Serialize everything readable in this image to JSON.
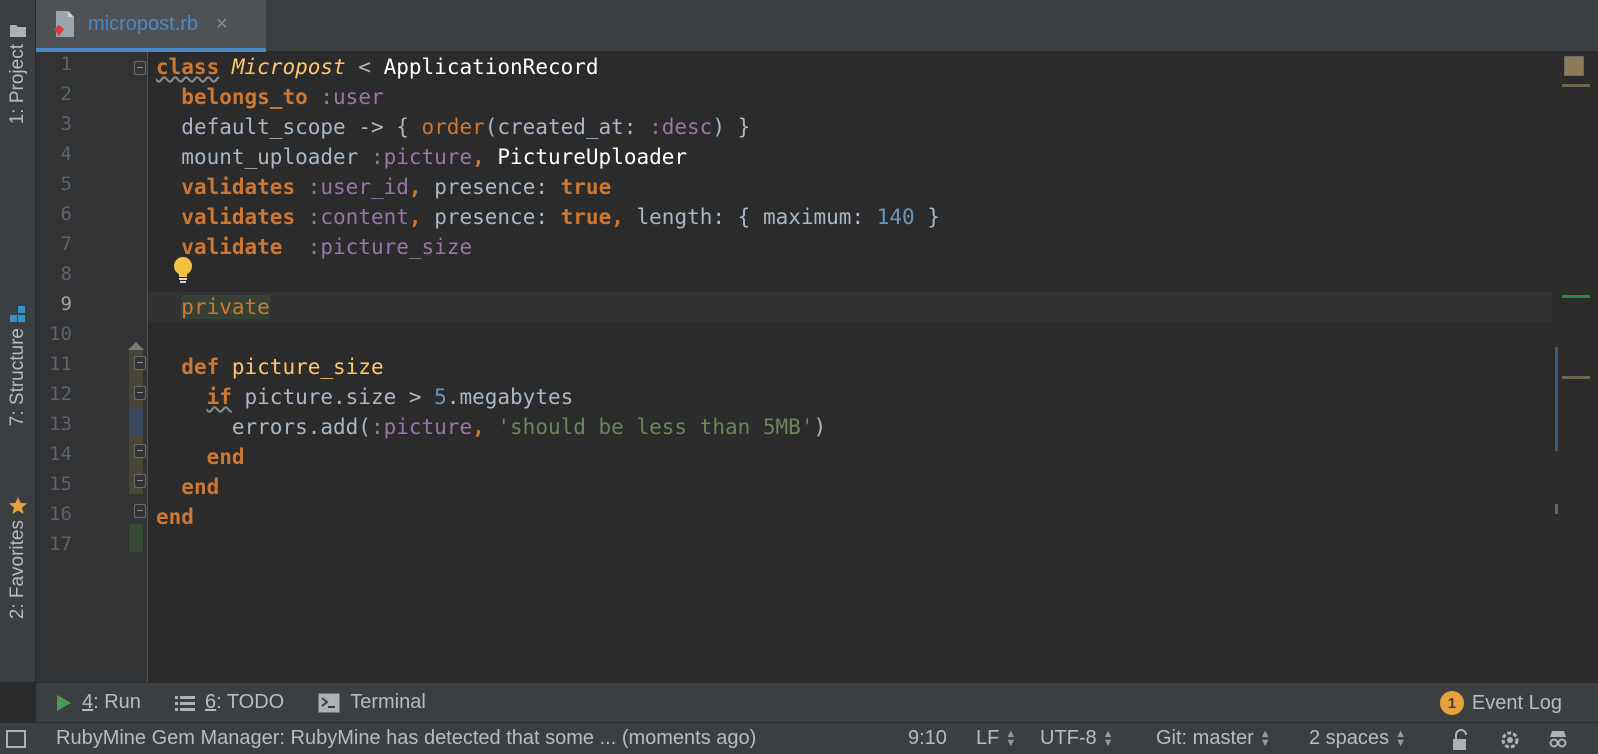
{
  "left_tabs": [
    {
      "label": "1: Project",
      "icon": "folder-icon"
    },
    {
      "label": "7: Structure",
      "icon": "structure-icon"
    },
    {
      "label": "2: Favorites",
      "icon": "star-icon"
    }
  ],
  "editor_tab": {
    "label": "micropost.rb",
    "close": "×"
  },
  "line_numbers": [
    "1",
    "2",
    "3",
    "4",
    "5",
    "6",
    "7",
    "8",
    "9",
    "10",
    "11",
    "12",
    "13",
    "14",
    "15",
    "16",
    "17"
  ],
  "current_line": "9",
  "code": {
    "l1": {
      "kw": "class",
      "name": "Micropost",
      "op": " < ",
      "parent": "ApplicationRecord"
    },
    "l2": {
      "call": "belongs_to",
      "sym": ":user"
    },
    "l3": {
      "a": "default_scope -> { ",
      "call": "order",
      "b": "(created_at: ",
      "sym": ":desc",
      "c": ") }"
    },
    "l4": {
      "a": "mount_uploader ",
      "sym": ":picture",
      "comma": ", ",
      "cls": "PictureUploader"
    },
    "l5": {
      "call": "validates",
      "sym": ":user_id",
      "comma": ", ",
      "key": "presence: ",
      "lit": "true"
    },
    "l6": {
      "call": "validates",
      "sym": ":content",
      "comma": ", ",
      "key": "presence: ",
      "lit": "true",
      "comma2": ", ",
      "key2": "length: { maximum: ",
      "num": "140",
      "end": " }"
    },
    "l7": {
      "call": "validate",
      "sym": "  :picture_size"
    },
    "l9": {
      "kw": "private"
    },
    "l11": {
      "kw": "def",
      "name": " picture_size"
    },
    "l12": {
      "kw": "if",
      "a": " picture.size > ",
      "num": "5",
      "b": ".megabytes"
    },
    "l13": {
      "a": "errors.add(",
      "sym": ":picture",
      "comma": ", ",
      "str": "'should be less than 5MB'",
      "b": ")"
    },
    "l14": {
      "kw": "end"
    },
    "l15": {
      "kw": "end"
    },
    "l16": {
      "kw": "end"
    }
  },
  "bottom_tools": {
    "run": {
      "num": "4",
      "label": ": Run"
    },
    "todo": {
      "num": "6",
      "label": ": TODO"
    },
    "terminal": {
      "label": "Terminal"
    },
    "event_log": {
      "count": "1",
      "label": "Event Log"
    }
  },
  "status": {
    "message": "RubyMine Gem Manager: RubyMine has detected that some ... (moments ago)",
    "position": "9:10",
    "line_sep": "LF",
    "encoding": "UTF-8",
    "vcs": "Git: master",
    "indent": "2 spaces"
  },
  "colors": {
    "keyword": "#cc7832",
    "method": "#ffc66d",
    "symbol": "#9876aa",
    "number": "#6897bb",
    "string": "#6a8759",
    "accent": "#4a88c7"
  }
}
